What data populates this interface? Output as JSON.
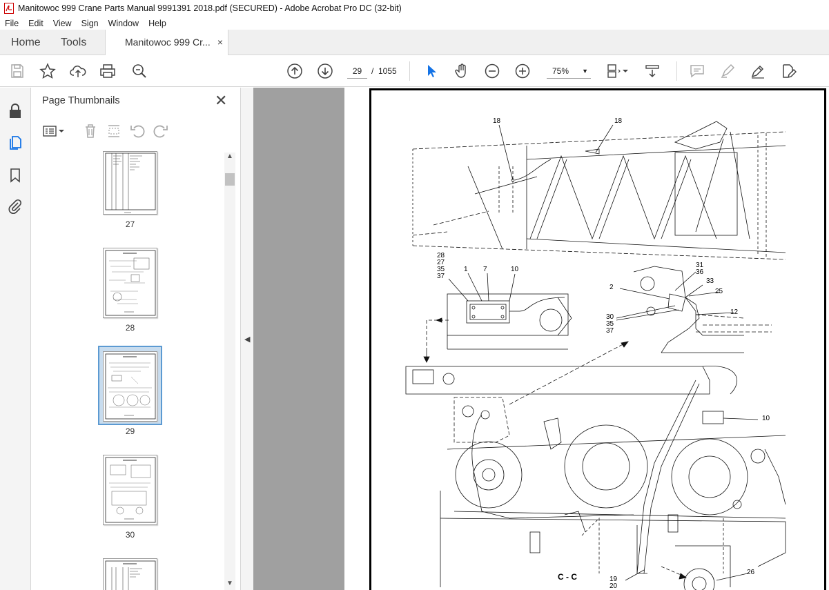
{
  "window": {
    "title": "Manitowoc 999 Crane Parts Manual 9991391 2018.pdf (SECURED) - Adobe Acrobat Pro DC (32-bit)"
  },
  "menu": [
    "File",
    "Edit",
    "View",
    "Sign",
    "Window",
    "Help"
  ],
  "tabs": {
    "home": "Home",
    "tools": "Tools",
    "document": "Manitowoc 999 Cr...",
    "close_glyph": "×"
  },
  "toolbar": {
    "current_page": "29",
    "page_separator": "/",
    "total_pages": "1055",
    "zoom": "75%",
    "zoom_arrow": "▼"
  },
  "panel": {
    "title": "Page Thumbnails",
    "close_glyph": "✕",
    "scroll_up": "▲",
    "scroll_down": "▼",
    "thumbnails": [
      {
        "label": "27",
        "selected": false
      },
      {
        "label": "28",
        "selected": false
      },
      {
        "label": "29",
        "selected": true
      },
      {
        "label": "30",
        "selected": false
      }
    ]
  },
  "splitter": {
    "collapse_glyph": "◀"
  },
  "drawing": {
    "callouts": {
      "c18a": "18",
      "c18b": "18",
      "c28": "28",
      "c27": "27",
      "c35a": "35",
      "c37a": "37",
      "c1": "1",
      "c7": "7",
      "c10a": "10",
      "c31": "31",
      "c36": "36",
      "c33": "33",
      "c2": "2",
      "c25": "25",
      "c30": "30",
      "c35b": "35",
      "c37b": "37",
      "c12": "12",
      "c10b": "10",
      "c26": "26",
      "c19": "19",
      "c20": "20"
    },
    "section_label": "C - C"
  },
  "colors": {
    "accent": "#1473e6",
    "select_blue": "#5c9ad2",
    "doc_gray": "#a0a0a0"
  }
}
